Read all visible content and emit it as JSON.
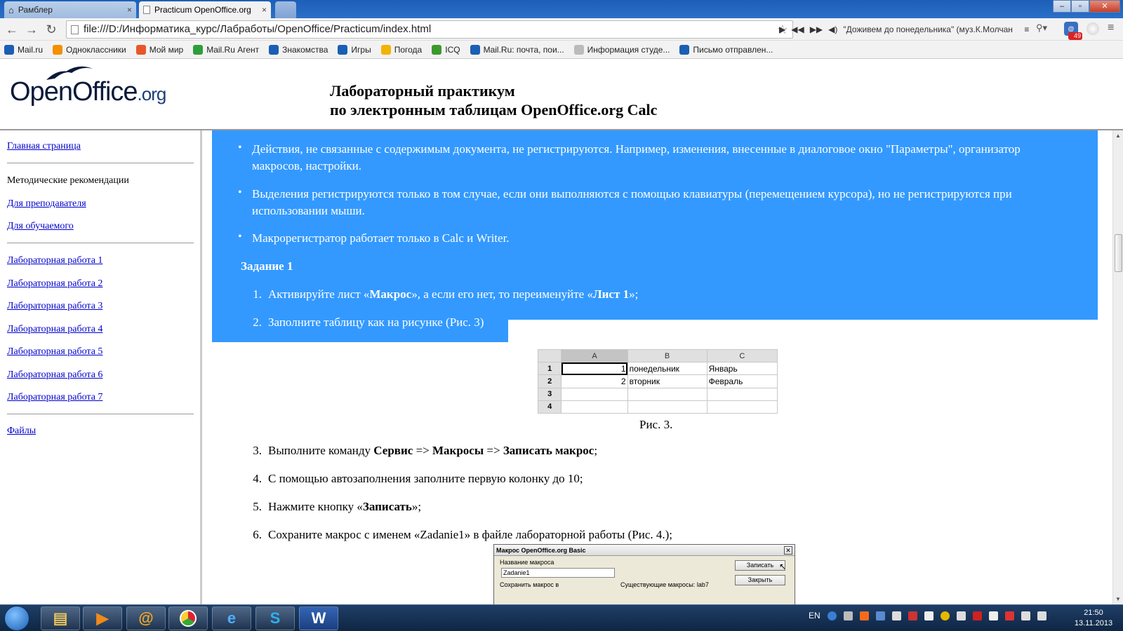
{
  "browser": {
    "tabs": [
      {
        "title": "Рамблер",
        "active": false
      },
      {
        "title": "Practicum OpenOffice.org",
        "active": true
      }
    ],
    "tab_close": "×",
    "address": "file:///D:/Информатика_курс/Лабработы/OpenOffice/Practicum/index.html",
    "media_track": "\"Доживем до понедельника\" (муз.К.Молчан",
    "extension_badge": "49",
    "bookmarks": [
      {
        "label": "Mail.ru",
        "color": "#1a5fb4"
      },
      {
        "label": "Одноклассники",
        "color": "#f39000"
      },
      {
        "label": "Мой мир",
        "color": "#e8562b"
      },
      {
        "label": "Mail.Ru Агент",
        "color": "#2f9e3a"
      },
      {
        "label": "Знакомства",
        "color": "#1a5fb4"
      },
      {
        "label": "Игры",
        "color": "#1a5fb4"
      },
      {
        "label": "Погода",
        "color": "#f2b300"
      },
      {
        "label": "ICQ",
        "color": "#3c9a2c"
      },
      {
        "label": "Mail.Ru: почта, пои...",
        "color": "#1a5fb4"
      },
      {
        "label": "Информация студе...",
        "color": "#bbbbbb"
      },
      {
        "label": "Письмо отправлен...",
        "color": "#1a5fb4"
      }
    ]
  },
  "site": {
    "logo_main": "OpenOffice",
    "logo_org": ".org",
    "title_line1": "Лабораторный практикум",
    "title_line2": "по электронным таблицам OpenOffice.org Calc"
  },
  "sidebar": {
    "home": "Главная страница",
    "methodics": "Методические рекомендации",
    "for_teacher": "Для преподавателя",
    "for_student": "Для обучаемого",
    "labs": [
      "Лабораторная работа 1",
      "Лабораторная работа 2",
      "Лабораторная работа 3",
      "Лабораторная работа 4",
      "Лабораторная работа 5",
      "Лабораторная работа 6",
      "Лабораторная работа 7"
    ],
    "files": "Файлы"
  },
  "content": {
    "bullets": [
      {
        "line1": "Действия, не связанные с содержимым документа, не регистрируются. Например, изменения, внесенные в диалоговое окно \"Параметры\", организатор",
        "line2": "макросов, настройки."
      },
      {
        "line1": "Выделения регистрируются только в том случае, если они выполняются с помощью клавиатуры (перемещением курсора), но не регистрируются при",
        "line2": "использовании мыши."
      },
      {
        "line1": "Макрорегистратор работает только в Calc и Writer.",
        "line2": ""
      }
    ],
    "task_heading": "Задание 1",
    "steps": {
      "s1": {
        "num": "1.",
        "a": "Активируйте лист «",
        "b": "Макрос",
        "c": "», а если его нет, то переименуйте «",
        "d": "Лист 1",
        "e": "»;"
      },
      "s2": {
        "num": "2.",
        "text": "Заполните таблицу как на рисунке (Рис. 3)"
      },
      "s3": {
        "num": "3.",
        "a": "Выполните команду ",
        "b": "Сервис",
        "c": " => ",
        "d": "Макросы",
        "e": " => ",
        "f": "Записать макрос",
        "g": ";"
      },
      "s4": {
        "num": "4.",
        "text": "С помощью автозаполнения заполните первую колонку до 10;"
      },
      "s5": {
        "num": "5.",
        "a": "Нажмите кнопку «",
        "b": "Записать",
        "c": "»;"
      },
      "s6": {
        "num": "6.",
        "text": "Сохраните макрос с именем «Zadanie1» в файле лабораторной работы (Рис. 4.);"
      }
    },
    "figure3": {
      "columns": [
        "A",
        "B",
        "C"
      ],
      "rows": [
        {
          "row": "1",
          "a": "1",
          "b": "понедельник",
          "c": "Январь"
        },
        {
          "row": "2",
          "a": "2",
          "b": "вторник",
          "c": "Февраль"
        },
        {
          "row": "3",
          "a": "",
          "b": "",
          "c": ""
        },
        {
          "row": "4",
          "a": "",
          "b": "",
          "c": ""
        }
      ],
      "caption": "Рис. 3."
    },
    "dialog": {
      "title": "Макрос OpenOffice.org Basic",
      "name_label": "Название макроса",
      "name_value": "Zadanie1",
      "save_in_label": "Сохранить макрос в",
      "existing_label": "Существующие макросы: lab7",
      "record_btn": "Записать",
      "close_btn": "Закрыть"
    }
  },
  "taskbar": {
    "lang": "EN",
    "time": "21:50",
    "date": "13.11.2013"
  },
  "colors": {
    "selection": "#3399ff",
    "link": "#0000cc",
    "taskbar": "#163356"
  }
}
